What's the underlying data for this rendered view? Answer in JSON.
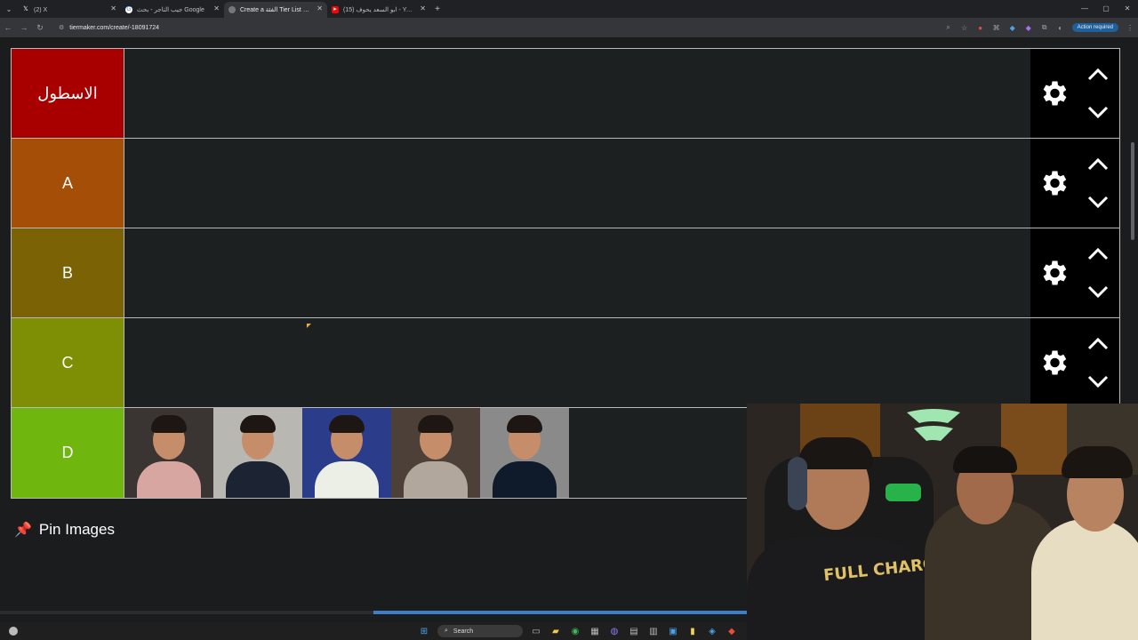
{
  "browser": {
    "tabs": [
      {
        "title": "(2) X",
        "favicon": "x-icon",
        "active": false
      },
      {
        "title": "جيب التاجر - بحث Google",
        "favicon": "google-icon",
        "active": false
      },
      {
        "title": "Create a الفئة Tier List - TierMaker",
        "favicon": "tiermaker-icon",
        "active": true
      },
      {
        "title": "(15) ابو السعد يحوف - YouTube",
        "favicon": "youtube-icon",
        "active": false
      }
    ],
    "url": "tiermaker.com/create/-18091724",
    "action_required": "Action required"
  },
  "tiers": [
    {
      "label": "الاسطول",
      "color": "#a80000"
    },
    {
      "label": "A",
      "color": "#a44e07"
    },
    {
      "label": "B",
      "color": "#7b6305"
    },
    {
      "label": "C",
      "color": "#7e8e05"
    },
    {
      "label": "D",
      "color": "#6fb70e"
    }
  ],
  "tier_d_items": [
    {
      "name": "person-1",
      "bg": "#3a3533",
      "shirt": "#d8a6a0"
    },
    {
      "name": "person-2",
      "bg": "#b8b7b2",
      "shirt": "#1c2333"
    },
    {
      "name": "person-3",
      "bg": "#2a3c8a",
      "shirt": "#ecefe6"
    },
    {
      "name": "person-4",
      "bg": "#4c4039",
      "shirt": "#b2a79c"
    },
    {
      "name": "person-5",
      "bg": "#8a8a8a",
      "shirt": "#0f1a2a"
    }
  ],
  "pin": {
    "label": "Pin Images"
  },
  "taskbar": {
    "search_label": "Search"
  },
  "webcam": {
    "shirt_text": "FULL CHARGE"
  }
}
